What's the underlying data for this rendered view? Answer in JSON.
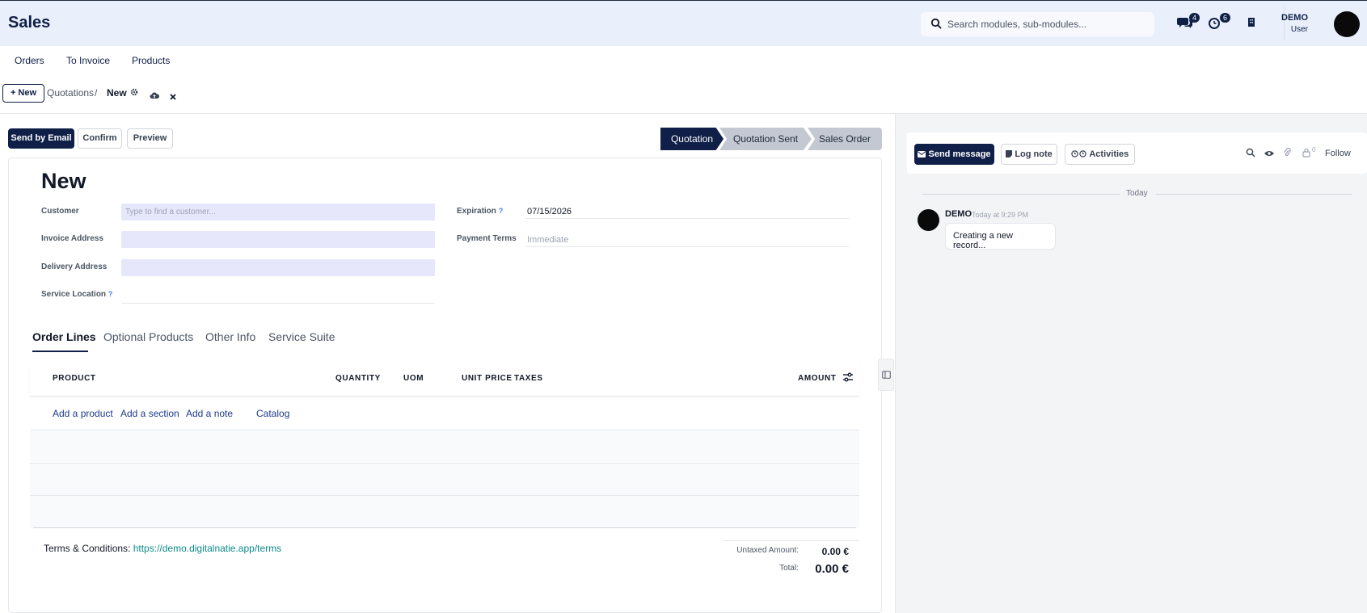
{
  "app": {
    "title": "Sales"
  },
  "search": {
    "placeholder": "Search modules, sub-modules..."
  },
  "systray": {
    "messages_count": "4",
    "activities_count": "6"
  },
  "user": {
    "name": "DEMO",
    "role": "User"
  },
  "menu": {
    "items": [
      "Orders",
      "To Invoice",
      "Products"
    ]
  },
  "control_panel": {
    "new_label": "+ New",
    "breadcrumb_parent": "Quotations",
    "breadcrumb_sep": "/",
    "breadcrumb_current": "New"
  },
  "actions": {
    "send_email": "Send by Email",
    "confirm": "Confirm",
    "preview": "Preview"
  },
  "status_bar": {
    "stages": [
      "Quotation",
      "Quotation Sent",
      "Sales Order"
    ],
    "active": "Quotation"
  },
  "form": {
    "title": "New",
    "customer": {
      "label": "Customer",
      "placeholder": "Type to find a customer..."
    },
    "invoice_address": {
      "label": "Invoice Address"
    },
    "delivery_address": {
      "label": "Delivery Address"
    },
    "service_location": {
      "label": "Service Location",
      "help": "?"
    },
    "expiration": {
      "label": "Expiration",
      "help": "?",
      "value": "07/15/2026"
    },
    "payment_terms": {
      "label": "Payment Terms",
      "placeholder": "Immediate"
    }
  },
  "tabs": [
    "Order Lines",
    "Optional Products",
    "Other Info",
    "Service Suite"
  ],
  "order_lines": {
    "columns": {
      "product": "PRODUCT",
      "quantity": "QUANTITY",
      "uom": "UOM",
      "unit_price": "UNIT PRICE",
      "taxes": "TAXES",
      "amount": "AMOUNT"
    },
    "add_links": {
      "product": "Add a product",
      "section": "Add a section",
      "note": "Add a note",
      "catalog": "Catalog"
    }
  },
  "terms": {
    "label": "Terms & Conditions:",
    "link": "https://demo.digitalnatie.app/terms"
  },
  "totals": {
    "untaxed_label": "Untaxed Amount:",
    "untaxed_value": "0.00 €",
    "total_label": "Total:",
    "total_value": "0.00 €"
  },
  "chatter": {
    "send_message": "Send message",
    "log_note": "Log note",
    "activities": "Activities",
    "attachments_count": "0",
    "follow": "Follow",
    "date_separator": "Today",
    "message": {
      "author": "DEMO",
      "time": "Today at 9:29 PM",
      "body": "Creating a new record..."
    }
  },
  "colors": {
    "brand": "#0f1f47",
    "topbar_bg": "#eaf0fb",
    "input_bg": "#e6e7fb",
    "link_teal": "#0e8a8a",
    "stage_inactive": "#c3c8d3"
  }
}
